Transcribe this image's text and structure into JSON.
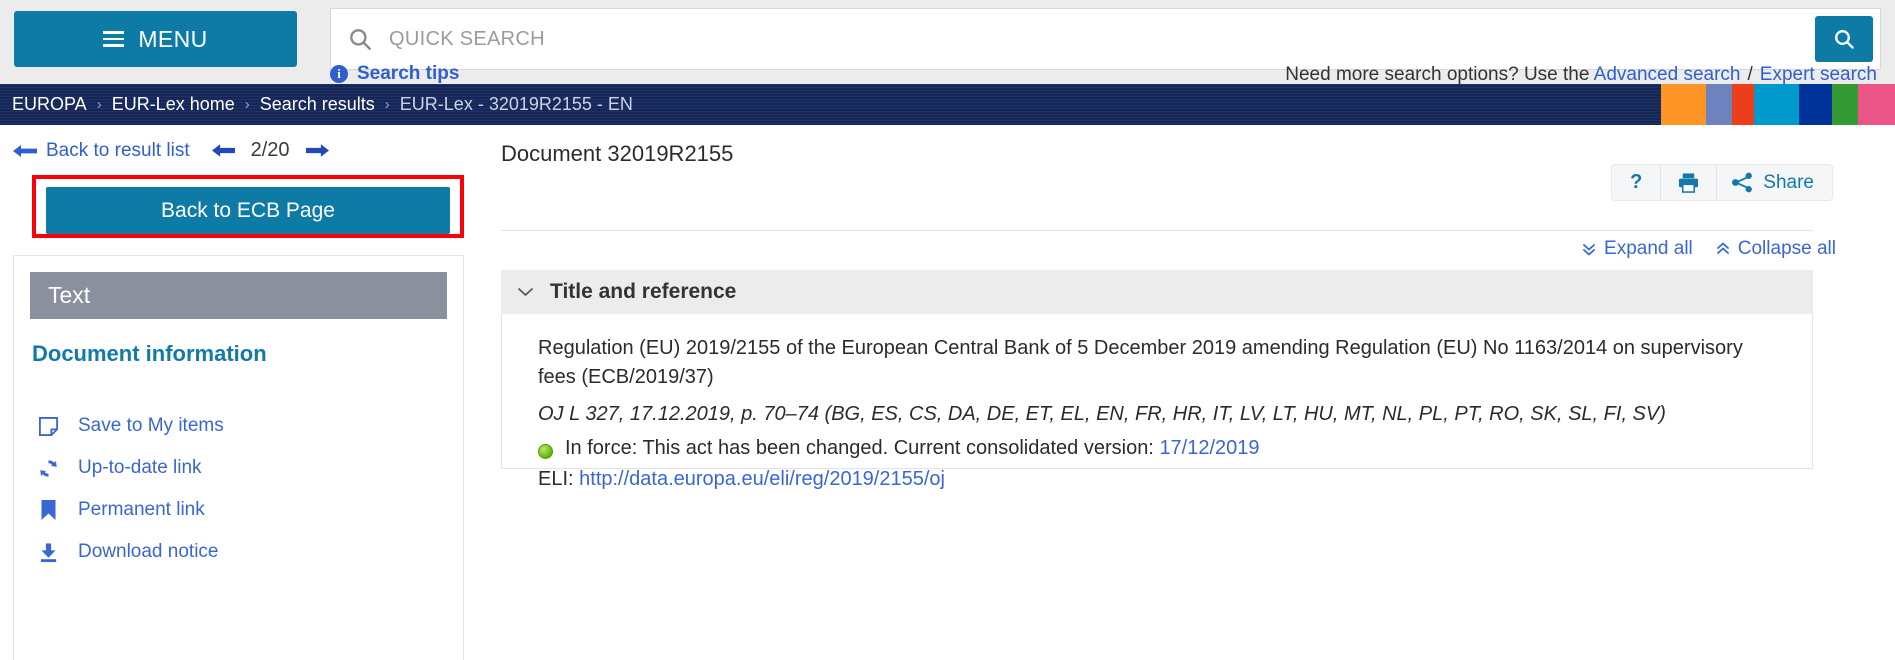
{
  "header": {
    "menu_label": "MENU",
    "menu_icon": "hamburger-icon",
    "search_placeholder": "QUICK SEARCH",
    "search_value": "",
    "search_icon": "search-icon",
    "search_button_icon": "search-icon",
    "search_tips_label": "Search tips",
    "search_tips_icon": "info-icon",
    "more_options_prefix": "Need more search options? Use the ",
    "advanced_search_label": "Advanced search",
    "separator": "/",
    "expert_search_label": "Expert search"
  },
  "breadcrumb": {
    "items": [
      {
        "label": "EUROPA",
        "current": false
      },
      {
        "label": "EUR-Lex home",
        "current": false
      },
      {
        "label": "Search results",
        "current": false
      },
      {
        "label": "EUR-Lex - 32019R2155 - EN",
        "current": true
      }
    ],
    "separator": "›",
    "background_color": "#16295c",
    "flag_colors": [
      "#ff9526",
      "#6d83bd",
      "#ea3e1c",
      "#0099cc",
      "#003399",
      "#339933",
      "#ea5486"
    ]
  },
  "sidebar": {
    "back_to_result_list_label": "Back to result list",
    "back_arrow_icon": "arrow-left-icon",
    "pager_prev_icon": "arrow-left-icon",
    "pager_next_icon": "arrow-right-icon",
    "pager_count": "2/20",
    "ecb_button_label": "Back to ECB Page",
    "ecb_button_color": "#0e7ba6",
    "highlight_color": "#fb0007",
    "panel_header": "Text",
    "document_information_label": "Document information",
    "items": [
      {
        "label": "Save to My items",
        "icon": "note-icon"
      },
      {
        "label": "Up-to-date link",
        "icon": "refresh-icon"
      },
      {
        "label": "Permanent link",
        "icon": "bookmark-icon"
      },
      {
        "label": "Download notice",
        "icon": "download-icon"
      }
    ]
  },
  "main": {
    "document_title": "Document 32019R2155",
    "tools": [
      {
        "label": "",
        "icon": "help-icon",
        "name": "help-button"
      },
      {
        "label": "",
        "icon": "print-icon",
        "name": "print-button"
      },
      {
        "label": "Share",
        "icon": "share-icon",
        "name": "share-button"
      }
    ],
    "expand_all_label": "Expand all",
    "expand_all_icon": "chevron-double-down-icon",
    "collapse_all_label": "Collapse all",
    "collapse_all_icon": "chevron-double-up-icon",
    "section": {
      "title": "Title and reference",
      "chevron_icon": "chevron-down-icon",
      "title_text": "Regulation (EU) 2019/2155 of the European Central Bank of 5 December 2019 amending Regulation (EU) No 1163/2014 on supervisory fees (ECB/2019/37)",
      "oj_reference": "OJ L 327, 17.12.2019, p. 70–74 (BG, ES, CS, DA, DE, ET, EL, EN, FR, HR, IT, LV, LT, HU, MT, NL, PL, PT, RO, SK, SL, FI, SV)",
      "status_prefix": "In force: This act has been changed. Current consolidated version: ",
      "status_date_link": "17/12/2019",
      "status_dot_color": "#6fc418",
      "eli_prefix": "ELI: ",
      "eli_link": "http://data.europa.eu/eli/reg/2019/2155/oj"
    }
  }
}
